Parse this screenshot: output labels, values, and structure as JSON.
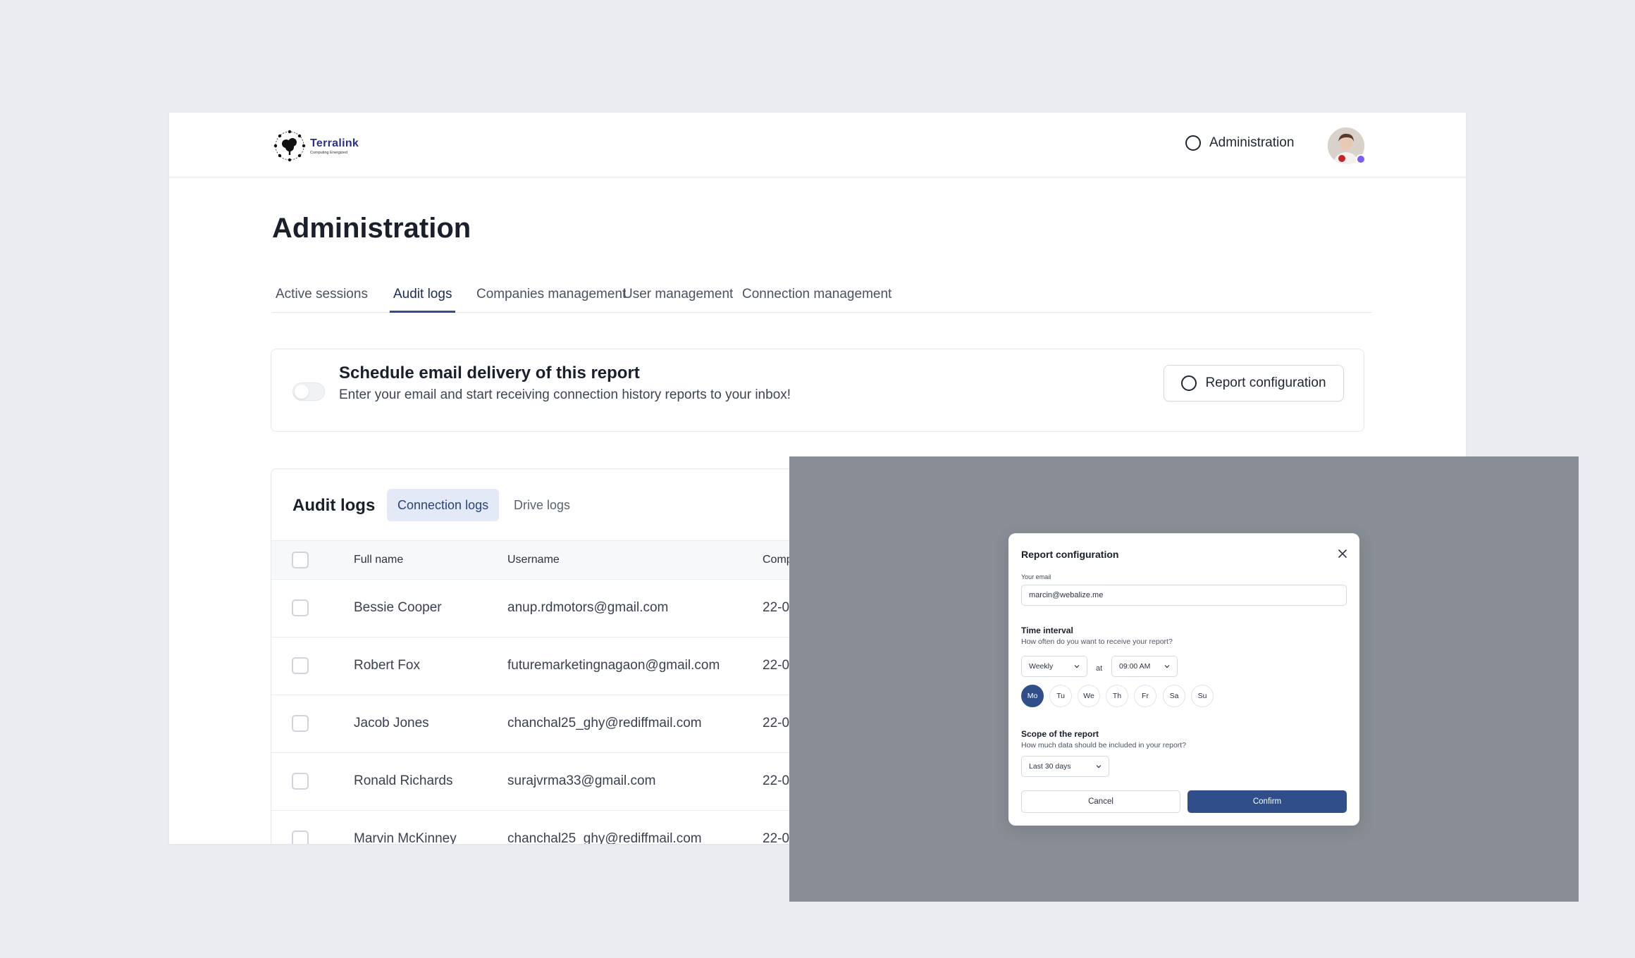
{
  "header": {
    "brand_name": "Terralink",
    "brand_tagline": "Computing Energized",
    "admin_link": "Administration",
    "logo_icon": "network-tree-logo",
    "admin_icon": "circle-icon"
  },
  "page": {
    "title": "Administration"
  },
  "tabs": [
    {
      "label": "Active sessions",
      "active": false
    },
    {
      "label": "Audit logs",
      "active": true
    },
    {
      "label": "Companies management",
      "active": false
    },
    {
      "label": "User management",
      "active": false
    },
    {
      "label": "Connection management",
      "active": false
    }
  ],
  "schedule": {
    "toggle_on": false,
    "title": "Schedule email delivery of this report",
    "description": "Enter your email and start receiving connection history reports to your inbox!",
    "button_label": "Report configuration"
  },
  "audit_logs": {
    "title": "Audit logs",
    "pills": [
      {
        "label": "Connection logs",
        "active": true
      },
      {
        "label": "Drive logs",
        "active": false
      }
    ],
    "columns": [
      "Full name",
      "Username",
      "Comp"
    ],
    "rows": [
      {
        "full_name": "Bessie Cooper",
        "username": "anup.rdmotors@gmail.com",
        "comp": "22-0"
      },
      {
        "full_name": "Robert Fox",
        "username": "futuremarketingnagaon@gmail.com",
        "comp": "22-0"
      },
      {
        "full_name": "Jacob Jones",
        "username": "chanchal25_ghy@rediffmail.com",
        "comp": "22-0"
      },
      {
        "full_name": "Ronald Richards",
        "username": "surajvrma33@gmail.com",
        "comp": "22-0"
      },
      {
        "full_name": "Marvin McKinney",
        "username": "chanchal25_ghy@rediffmail.com",
        "comp": "22-0"
      }
    ]
  },
  "modal": {
    "title": "Report configuration",
    "email_label": "Your email",
    "email_value": "marcin@webalize.me",
    "interval_title": "Time interval",
    "interval_desc": "How often do you want to receive your report?",
    "frequency": "Weekly",
    "at_label": "at",
    "time": "09:00 AM",
    "days": [
      {
        "label": "Mo",
        "active": true
      },
      {
        "label": "Tu",
        "active": false
      },
      {
        "label": "We",
        "active": false
      },
      {
        "label": "Th",
        "active": false
      },
      {
        "label": "Fr",
        "active": false
      },
      {
        "label": "Sa",
        "active": false
      },
      {
        "label": "Su",
        "active": false
      }
    ],
    "scope_title": "Scope of the report",
    "scope_desc": "How much data should be included in your report?",
    "scope_value": "Last 30 days",
    "cancel_label": "Cancel",
    "confirm_label": "Confirm"
  },
  "colors": {
    "accent": "#2f4e8a",
    "pill_active_bg": "#e3e9f6",
    "overlay": "#898e96",
    "page_bg": "#eaecef"
  }
}
